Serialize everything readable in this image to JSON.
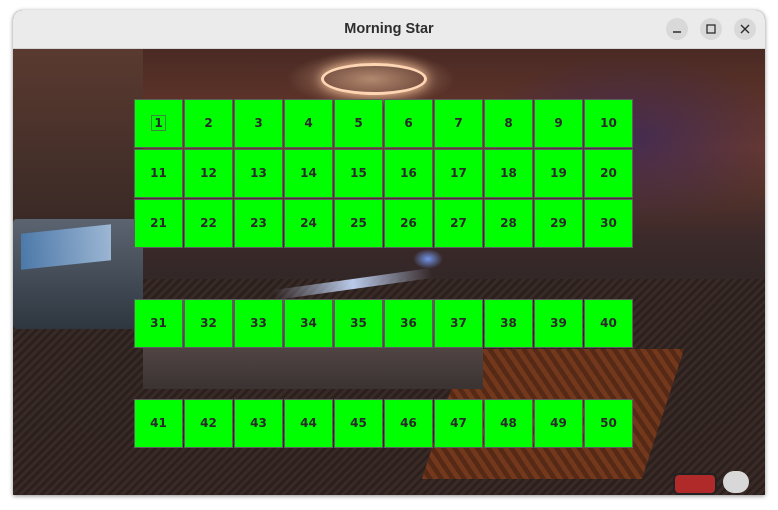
{
  "window": {
    "title": "Morning Star"
  },
  "controls": {
    "minimize_icon": "minimize-icon",
    "maximize_icon": "maximize-icon",
    "close_icon": "close-icon"
  },
  "grid": {
    "color": "#00ff00",
    "focused": "1",
    "row1": [
      "1",
      "2",
      "3",
      "4",
      "5",
      "6",
      "7",
      "8",
      "9",
      "10"
    ],
    "row2": [
      "11",
      "12",
      "13",
      "14",
      "15",
      "16",
      "17",
      "18",
      "19",
      "20"
    ],
    "row3": [
      "21",
      "22",
      "23",
      "24",
      "25",
      "26",
      "27",
      "28",
      "29",
      "30"
    ],
    "row4": [
      "31",
      "32",
      "33",
      "34",
      "35",
      "36",
      "37",
      "38",
      "39",
      "40"
    ],
    "row5": [
      "41",
      "42",
      "43",
      "44",
      "45",
      "46",
      "47",
      "48",
      "49",
      "50"
    ]
  }
}
